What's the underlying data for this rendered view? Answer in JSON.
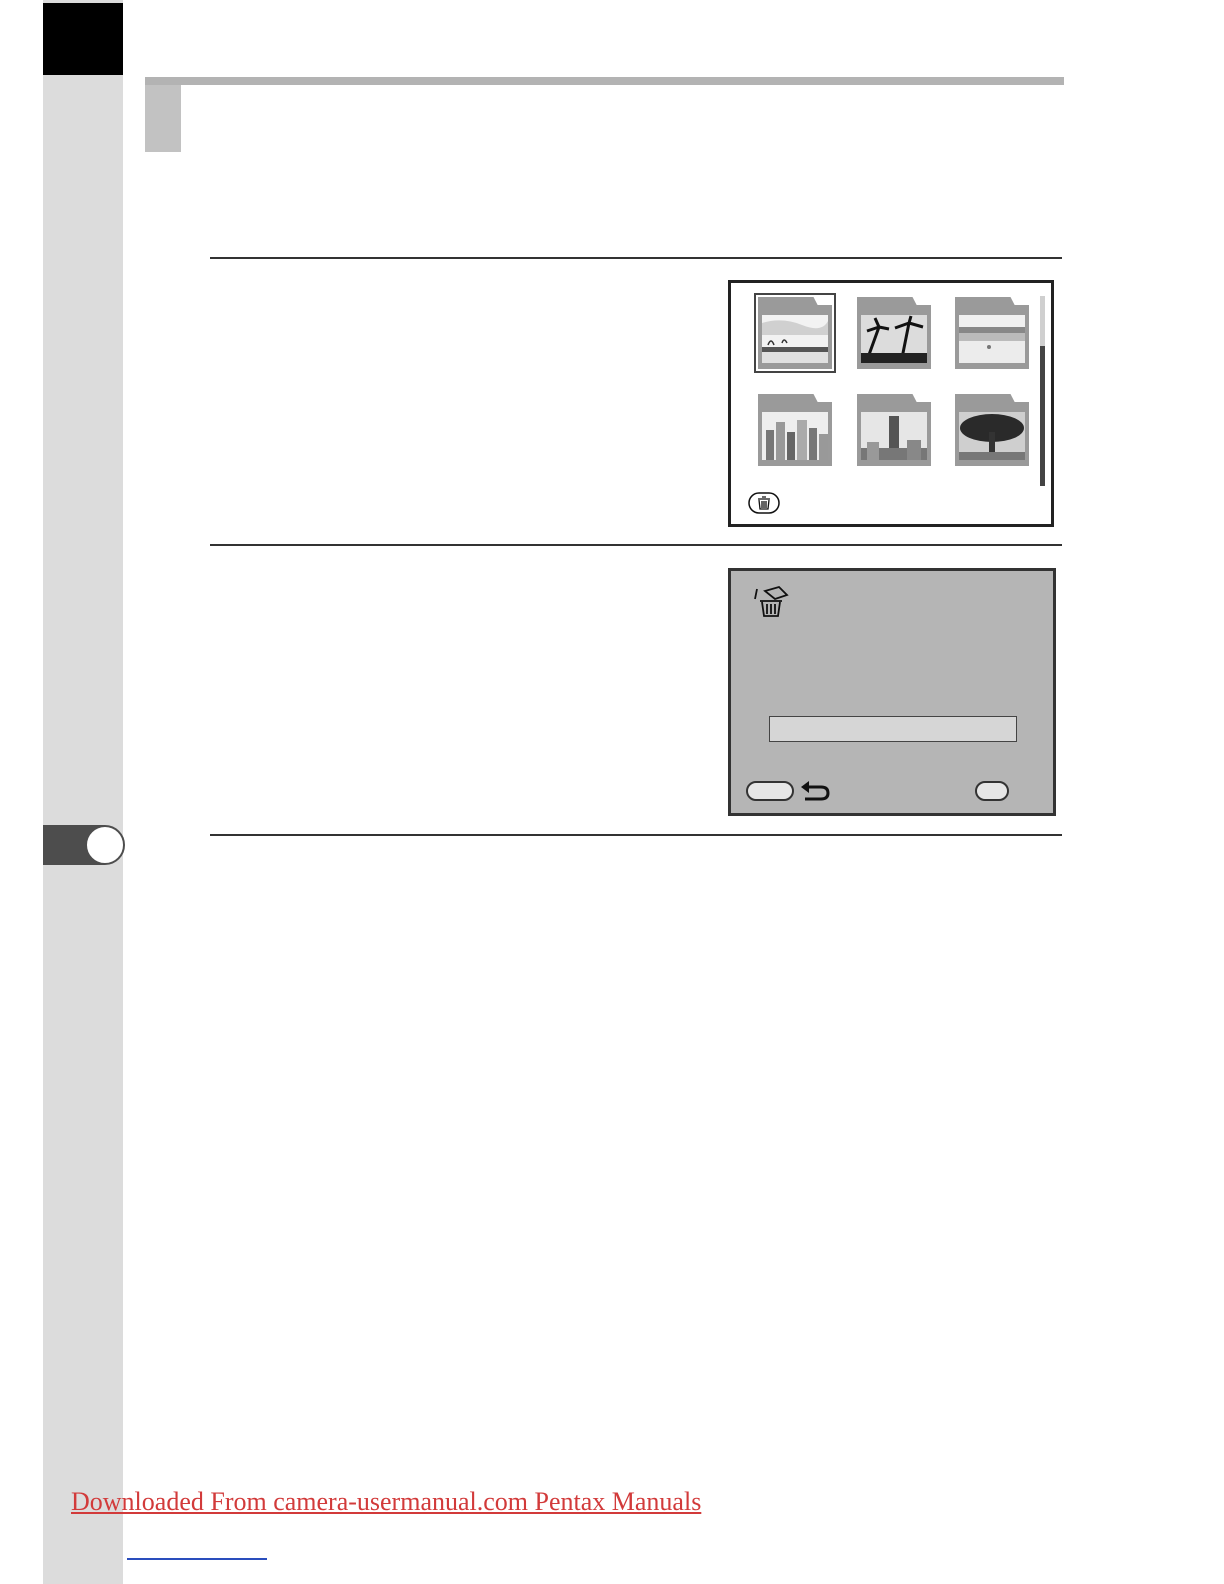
{
  "footer": {
    "link_text": "Downloaded From camera-usermanual.com Pentax Manuals"
  },
  "screen_folders": {
    "folders": [
      {
        "icon": "folder-beach-icon",
        "selected": true
      },
      {
        "icon": "folder-palms-icon",
        "selected": false
      },
      {
        "icon": "folder-shore-icon",
        "selected": false
      },
      {
        "icon": "folder-city-icon",
        "selected": false
      },
      {
        "icon": "folder-tower-icon",
        "selected": false
      },
      {
        "icon": "folder-tree-icon",
        "selected": false
      }
    ],
    "scroll_position": 0.25,
    "delete_button_icon": "trash-icon"
  },
  "screen_delete": {
    "header_icon": "delete-folder-icon",
    "progress": 0,
    "back_icon": "return-arrow-icon"
  },
  "colors": {
    "sidebar": "#dcdcdc",
    "tab_marker": "#4d4d4d",
    "lcd_background": "#b5b5b5",
    "footer_link": "#d23a3a"
  }
}
